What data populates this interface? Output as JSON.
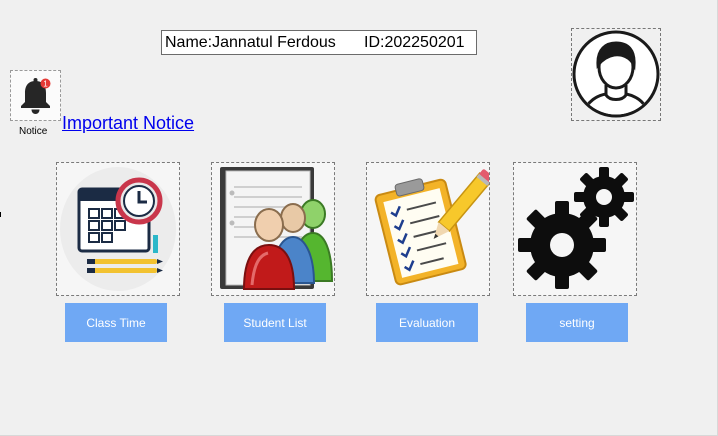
{
  "header": {
    "name_text": "Name:Jannatul Ferdous",
    "id_text": "ID:202250201"
  },
  "notice": {
    "label": "Notice",
    "badge_count": "1",
    "link_text": "Important Notice"
  },
  "tiles": [
    {
      "icon": "calendar-clock-icon",
      "button_label": "Class Time"
    },
    {
      "icon": "student-group-icon",
      "button_label": "Student List"
    },
    {
      "icon": "clipboard-checklist-icon",
      "button_label": "Evaluation"
    },
    {
      "icon": "gears-icon",
      "button_label": "setting"
    }
  ],
  "colors": {
    "button_bg": "#6fa8f4",
    "link": "#0000ee",
    "window_bg": "#f0f0f0"
  }
}
